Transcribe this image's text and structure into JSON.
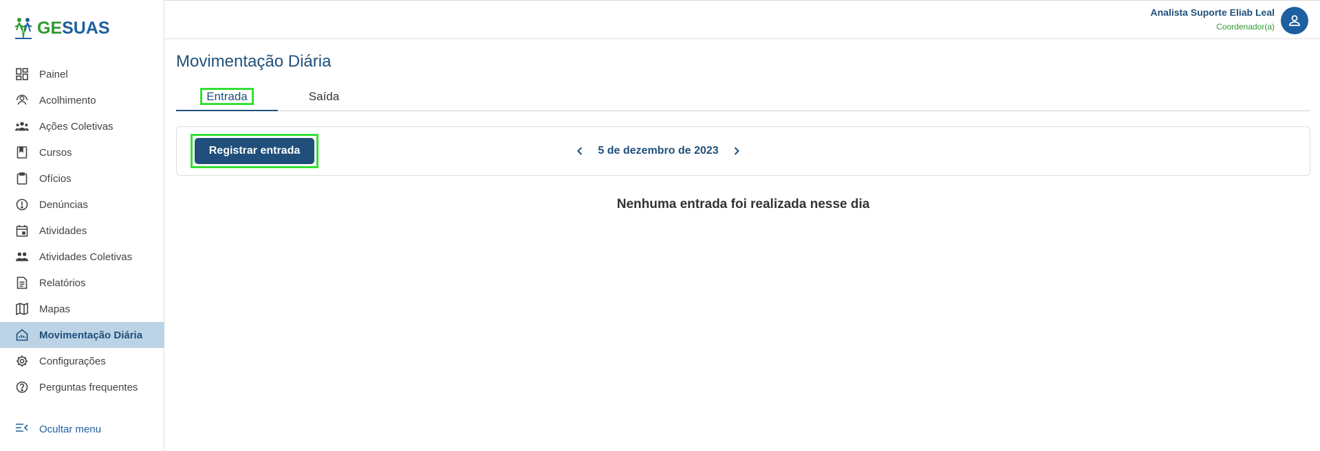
{
  "brand": {
    "logo_ge": "GE",
    "logo_suas": "SUAS",
    "green": "#2e9b2e",
    "blue": "#1d5fa0"
  },
  "sidebar": {
    "items": [
      {
        "label": "Painel",
        "icon": "dashboard-icon"
      },
      {
        "label": "Acolhimento",
        "icon": "people-circle-icon"
      },
      {
        "label": "Ações Coletivas",
        "icon": "group-icon"
      },
      {
        "label": "Cursos",
        "icon": "book-icon"
      },
      {
        "label": "Ofícios",
        "icon": "clipboard-icon"
      },
      {
        "label": "Denúncias",
        "icon": "alert-circle-icon"
      },
      {
        "label": "Atividades",
        "icon": "calendar-icon"
      },
      {
        "label": "Atividades Coletivas",
        "icon": "groups-icon"
      },
      {
        "label": "Relatórios",
        "icon": "document-icon"
      },
      {
        "label": "Mapas",
        "icon": "map-icon"
      },
      {
        "label": "Movimentação Diária",
        "icon": "home-chart-icon",
        "active": true
      },
      {
        "label": "Configurações",
        "icon": "gear-icon"
      },
      {
        "label": "Perguntas frequentes",
        "icon": "help-icon"
      }
    ],
    "hide_menu_label": "Ocultar menu"
  },
  "header": {
    "user_name": "Analista Suporte Eliab Leal",
    "user_role": "Coordenador(a)"
  },
  "main": {
    "title": "Movimentação Diária",
    "tabs": [
      {
        "label": "Entrada",
        "active": true
      },
      {
        "label": "Saída",
        "active": false
      }
    ],
    "register_button": "Registrar entrada",
    "date": "5 de dezembro de 2023",
    "empty_message": "Nenhuma entrada foi realizada nesse dia"
  }
}
